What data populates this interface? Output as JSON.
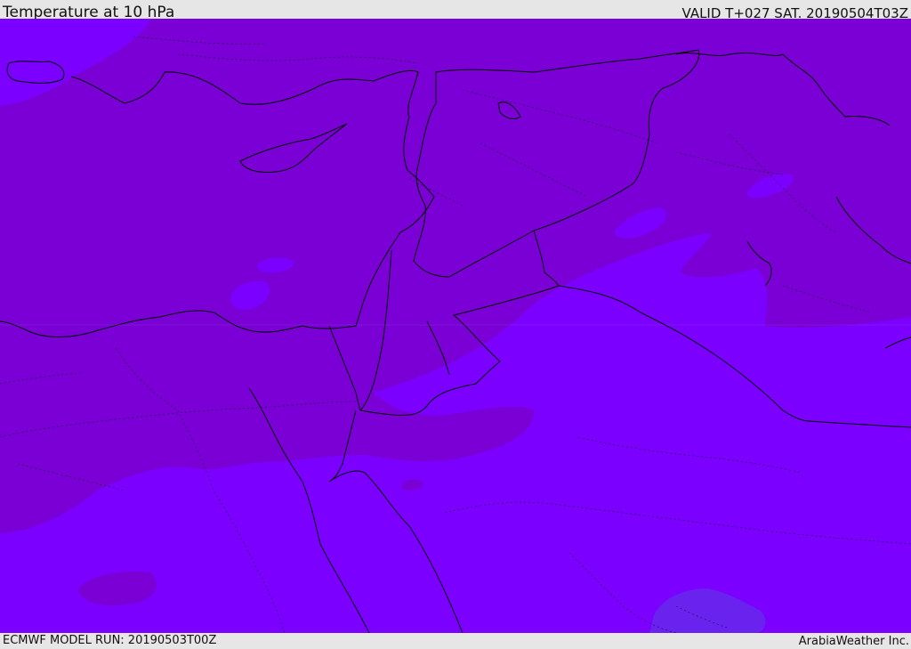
{
  "header": {
    "title": "Temperature at 10 hPa",
    "valid_time": "VALID T+027 SAT. 20190504T03Z"
  },
  "footer": {
    "model_run": "ECMWF MODEL RUN: 20190503T00Z",
    "credit": "ArabiaWeather Inc."
  },
  "colors": {
    "warm_band": "#7a00d6",
    "cold_band": "#7b00ff",
    "cold_patch": "#6a22ee",
    "borders": "#000000"
  }
}
